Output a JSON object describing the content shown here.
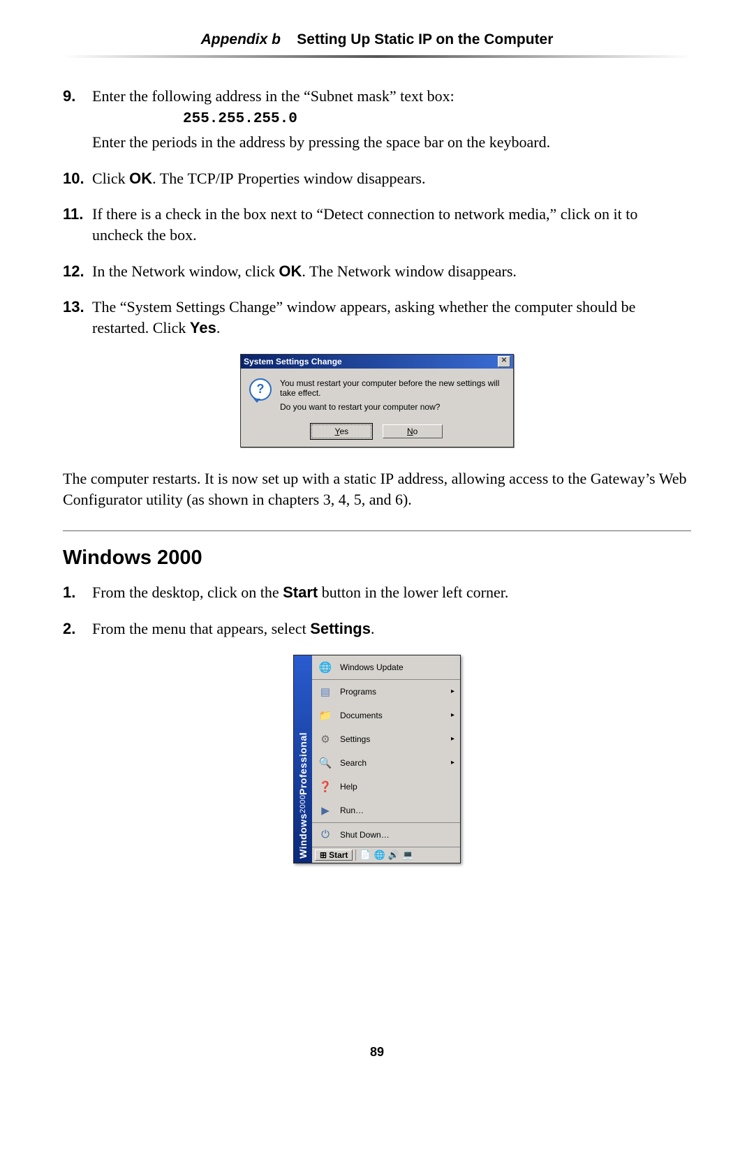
{
  "header": {
    "prefix": "Appendix b",
    "title": "Setting Up Static IP on the Computer"
  },
  "steps_a": [
    {
      "num": "9.",
      "line1": "Enter the following address in the “Subnet mask” text box:",
      "code": "255.255.255.0",
      "line2": "Enter the periods in the address by pressing the space bar on the keyboard."
    },
    {
      "num": "10.",
      "before_ok": "Click ",
      "ok": "OK",
      "after_ok_1": ". The ",
      "smallcaps": "TCP/IP",
      "after_ok_2": " Properties window disappears."
    },
    {
      "num": "11.",
      "text": "If there is a check in the box next to “Detect connection to network media,” click on it to uncheck the box."
    },
    {
      "num": "12.",
      "before": "In the Network window, click ",
      "ok": "OK",
      "after": ". The Network window disappears."
    },
    {
      "num": "13.",
      "before": "The “System Settings Change” window appears, asking whether the computer should be restarted. Click ",
      "yes": "Yes",
      "after": "."
    }
  ],
  "dialog": {
    "title": "System Settings Change",
    "line1": "You must restart your computer before the new settings will take effect.",
    "line2": "Do you want to restart your computer now?",
    "yes_u": "Y",
    "yes_rest": "es",
    "no_u": "N",
    "no_rest": "o",
    "close_glyph": "✕",
    "q_glyph": "?"
  },
  "after_text_before": "The computer restarts. It is now set up with a static ",
  "after_smallcaps": "IP",
  "after_text_after": " address, allowing access to the Gateway’s Web Configurator utility (as shown in chapters 3, 4, 5, and 6).",
  "section2": {
    "title": "Windows 2000",
    "steps": [
      {
        "num": "1.",
        "before": "From the desktop, click on the ",
        "bold": "Start",
        "after": " button in the lower left corner."
      },
      {
        "num": "2.",
        "before": "From the menu that appears, select ",
        "bold": "Settings",
        "after": "."
      }
    ]
  },
  "startmenu": {
    "sidebar_a": "Windows",
    "sidebar_year": "2000",
    "sidebar_b": "Professional",
    "items": [
      {
        "label": "Windows Update",
        "arrow": "",
        "sep": false,
        "icon": "🌐",
        "cls": "ic-globe",
        "name": "menu-windows-update"
      },
      {
        "label": "Programs",
        "arrow": "▸",
        "sep": true,
        "icon": "▤",
        "cls": "ic-programs",
        "name": "menu-programs"
      },
      {
        "label": "Documents",
        "arrow": "▸",
        "sep": false,
        "icon": "📁",
        "cls": "ic-folder",
        "name": "menu-documents"
      },
      {
        "label": "Settings",
        "arrow": "▸",
        "sep": false,
        "icon": "⚙",
        "cls": "ic-gear",
        "name": "menu-settings"
      },
      {
        "label": "Search",
        "arrow": "▸",
        "sep": false,
        "icon": "🔍",
        "cls": "ic-search",
        "name": "menu-search"
      },
      {
        "label": "Help",
        "arrow": "",
        "sep": false,
        "icon": "❓",
        "cls": "ic-help",
        "name": "menu-help"
      },
      {
        "label": "Run…",
        "arrow": "",
        "sep": false,
        "icon": "▶",
        "cls": "ic-run",
        "name": "menu-run"
      },
      {
        "label": "Shut Down…",
        "arrow": "",
        "sep": true,
        "icon": "⏻",
        "cls": "ic-shut",
        "name": "menu-shutdown"
      }
    ],
    "start_label": "Start",
    "start_flag": "⊞",
    "tray": [
      "📄",
      "🌐",
      "🔊",
      "💻"
    ]
  },
  "page_number": "89"
}
